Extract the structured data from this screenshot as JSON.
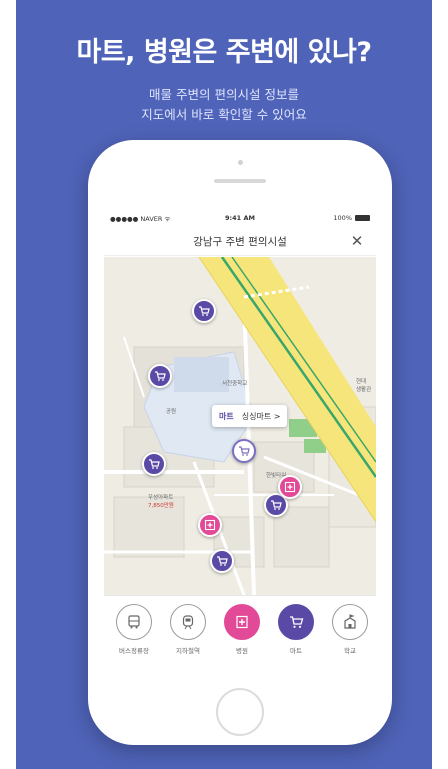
{
  "headline": "마트, 병원은 주변에 있나?",
  "subline1": "매물 주변의 편의시설 정보를",
  "subline2": "지도에서 바로 확인할 수 있어요",
  "colors": {
    "banner": "#4f63b8",
    "mart_marker": "#5a4aa6",
    "hospital_marker": "#e24a97",
    "road_yellow": "#f6e57a",
    "road_green": "#3aa66a"
  },
  "status_bar": {
    "carrier": "●●●●● NAVER ᯤ",
    "time": "9:41 AM",
    "battery": "100%"
  },
  "screen_title": "강남구 주변 편의시설",
  "close_icon": "close-icon",
  "callout": {
    "category": "마트",
    "name": "싱싱마트 >"
  },
  "map_labels": {
    "school": "서천중학교",
    "park": "공원",
    "apt": "우성아파트",
    "apt_price": "7,850만원",
    "building": "한빛타워",
    "side": "현대\n생활관"
  },
  "categories": [
    {
      "label": "버스정류장",
      "icon": "bus-icon"
    },
    {
      "label": "지하철역",
      "icon": "subway-icon"
    },
    {
      "label": "병원",
      "icon": "hospital-icon"
    },
    {
      "label": "마트",
      "icon": "cart-icon"
    },
    {
      "label": "학교",
      "icon": "school-icon"
    }
  ]
}
